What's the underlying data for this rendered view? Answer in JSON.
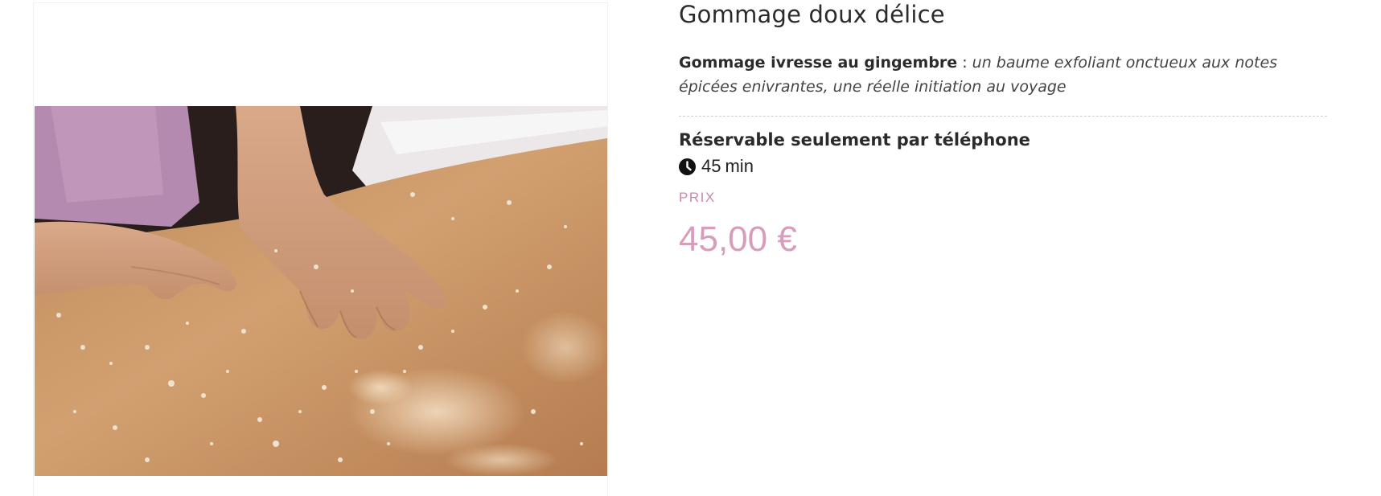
{
  "product": {
    "image_alt": "Massage avec gommage au sel sur le dos",
    "title": "Gommage doux délice",
    "description": {
      "name": "Gommage ivresse au gingembre",
      "separator": " : ",
      "text": "un baume exfoliant onctueux aux notes épicées enivrantes, une réelle initiation au voyage"
    },
    "booking_note": "Réservable seulement par téléphone",
    "duration": {
      "icon": "clock-icon",
      "value": "45",
      "unit": "min"
    },
    "price": {
      "label": "PRIX",
      "value": "45,00 €"
    }
  },
  "colors": {
    "accent_pink": "#d89dbb",
    "label_pink": "#c98aa9",
    "text": "#2b2b2b"
  }
}
